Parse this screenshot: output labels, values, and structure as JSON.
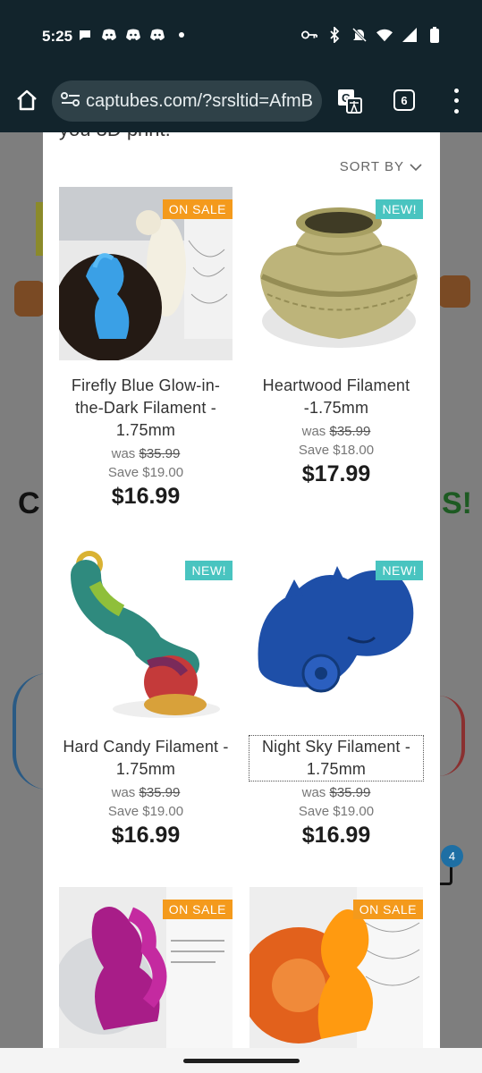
{
  "status": {
    "time": "5:25"
  },
  "browser": {
    "url": "captubes.com/?srsltid=AfmB",
    "tab_count": "6"
  },
  "background": {
    "left_letter": "C",
    "right_text": "S!",
    "cart_count": "4"
  },
  "listing": {
    "cut_text": "you 3D print.",
    "sort_label": "SORT BY",
    "products": [
      {
        "title": "Firefly Blue Glow-in-the-Dark Filament - 1.75mm",
        "badge": "ON SALE",
        "was_label": "was",
        "was_price": "$35.99",
        "save": "Save $19.00",
        "price": "$16.99"
      },
      {
        "title": "Heartwood Filament -1.75mm",
        "badge": "NEW!",
        "was_label": "was",
        "was_price": "$35.99",
        "save": "Save $18.00",
        "price": "$17.99"
      },
      {
        "title": "Hard Candy Filament - 1.75mm",
        "badge": "NEW!",
        "was_label": "was",
        "was_price": "$35.99",
        "save": "Save $19.00",
        "price": "$16.99"
      },
      {
        "title": "Night Sky Filament - 1.75mm",
        "badge": "NEW!",
        "was_label": "was",
        "was_price": "$35.99",
        "save": "Save $19.00",
        "price": "$16.99"
      },
      {
        "badge": "ON SALE"
      },
      {
        "badge": "ON SALE"
      }
    ]
  }
}
